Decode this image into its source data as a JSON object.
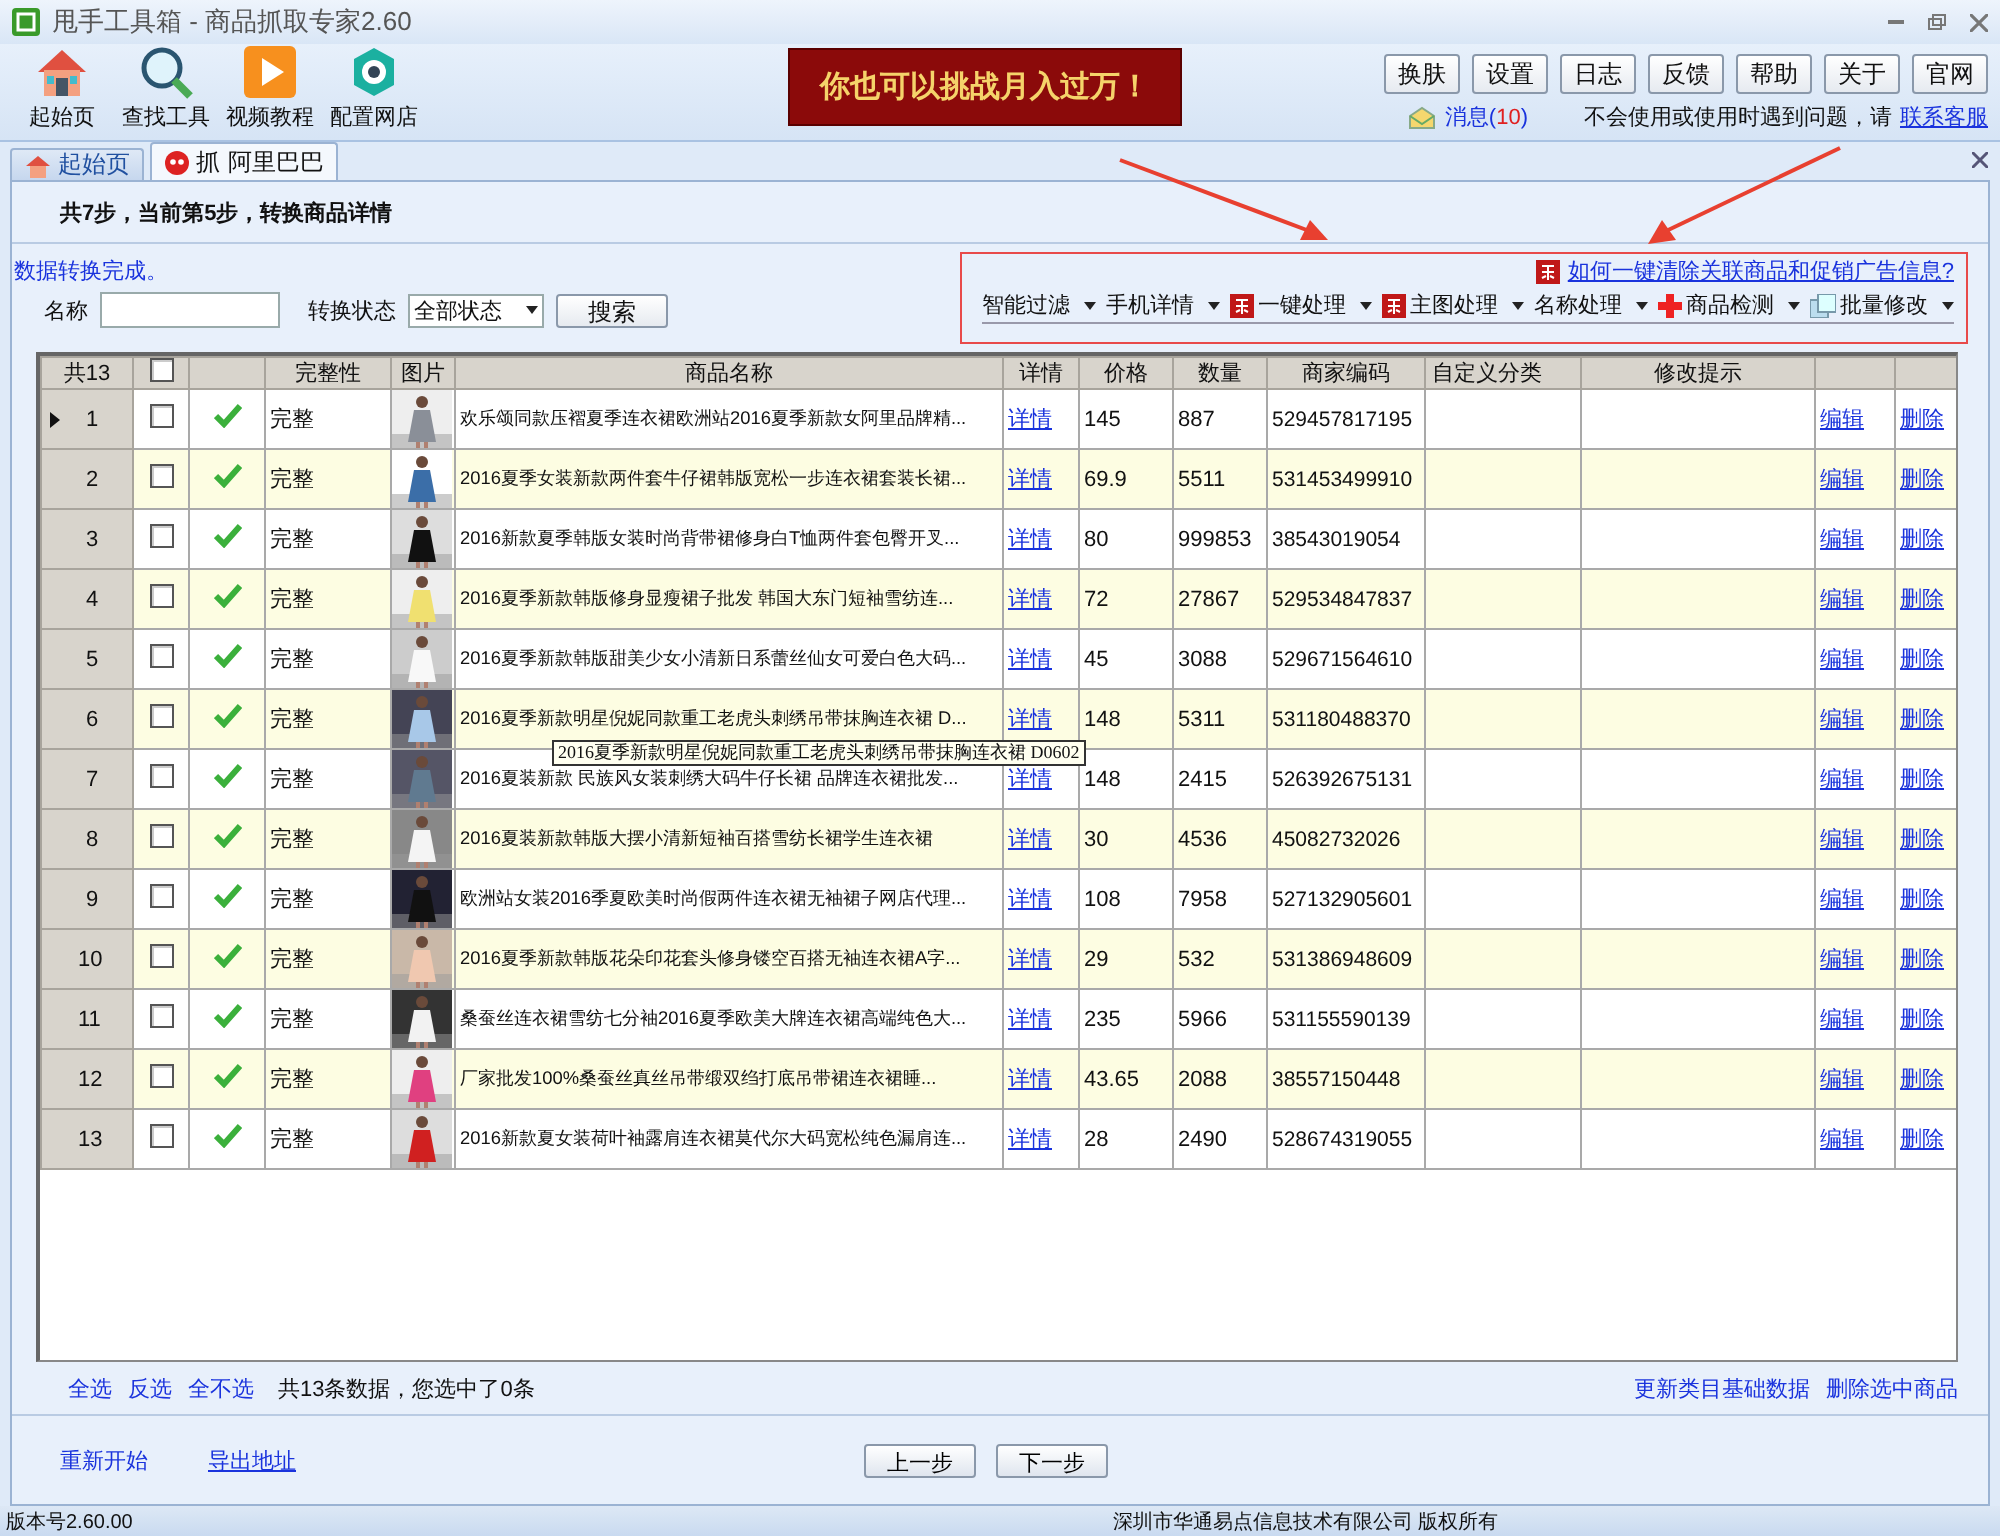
{
  "window": {
    "title": "甩手工具箱 - 商品抓取专家2.60"
  },
  "toolbar": [
    {
      "label": "起始页",
      "kind": "home"
    },
    {
      "label": "查找工具",
      "kind": "search"
    },
    {
      "label": "视频教程",
      "kind": "video"
    },
    {
      "label": "配置网店",
      "kind": "settings"
    }
  ],
  "banner": "你也可以挑战月入过万！",
  "top_buttons": [
    "换肤",
    "设置",
    "日志",
    "反馈",
    "帮助",
    "关于",
    "官网"
  ],
  "messages": {
    "label": "消息(",
    "count": "10",
    "close": ")"
  },
  "help": {
    "text": "不会使用或使用时遇到问题，请",
    "link": "联系客服"
  },
  "tabs": [
    {
      "label": "起始页",
      "selected": false,
      "kind": "home"
    },
    {
      "label": "抓 阿里巴巴",
      "selected": true,
      "kind": "grab"
    }
  ],
  "step": "共7步，当前第5步，转换商品详情",
  "status_message": "数据转换完成。",
  "filter": {
    "name_label": "名称",
    "status_label": "转换状态",
    "status_value": "全部状态",
    "search_button": "搜索"
  },
  "help_link": "如何一键清除关联商品和促销广告信息?",
  "menu": [
    {
      "label": "智能过滤",
      "kind": "plain"
    },
    {
      "label": "手机详情",
      "kind": "plain"
    },
    {
      "label": "一键处理",
      "kind": "new"
    },
    {
      "label": "主图处理",
      "kind": "new"
    },
    {
      "label": "名称处理",
      "kind": "plain"
    },
    {
      "label": "商品检测",
      "kind": "plus"
    },
    {
      "label": "批量修改",
      "kind": "batch"
    }
  ],
  "table": {
    "count_label": "共13",
    "all_checked": false,
    "columns": [
      "完整性",
      "图片",
      "商品名称",
      "详情",
      "价格",
      "数量",
      "商家编码",
      "自定义分类",
      "修改提示"
    ],
    "rows": [
      {
        "index": "1",
        "selected": true,
        "checked": false,
        "complete": true,
        "integrity": "完整",
        "name": "欢乐颂同款压褶夏季连衣裙欧洲站2016夏季新款女阿里品牌精...",
        "detail": "详情",
        "price": "145",
        "qty": "887",
        "code": "529457817195",
        "edit": "编辑",
        "delete": "删除"
      },
      {
        "index": "2",
        "selected": false,
        "checked": false,
        "complete": true,
        "integrity": "完整",
        "name": "2016夏季女装新款两件套牛仔裙韩版宽松一步连衣裙套装长裙...",
        "detail": "详情",
        "price": "69.9",
        "qty": "5511",
        "code": "531453499910",
        "edit": "编辑",
        "delete": "删除"
      },
      {
        "index": "3",
        "selected": false,
        "checked": false,
        "complete": true,
        "integrity": "完整",
        "name": "2016新款夏季韩版女装时尚背带裙修身白T恤两件套包臀开叉...",
        "detail": "详情",
        "price": "80",
        "qty": "999853",
        "code": "38543019054",
        "edit": "编辑",
        "delete": "删除"
      },
      {
        "index": "4",
        "selected": false,
        "checked": false,
        "complete": true,
        "integrity": "完整",
        "name": "2016夏季新款韩版修身显瘦裙子批发 韩国大东门短袖雪纺连...",
        "detail": "详情",
        "price": "72",
        "qty": "27867",
        "code": "529534847837",
        "edit": "编辑",
        "delete": "删除"
      },
      {
        "index": "5",
        "selected": false,
        "checked": false,
        "complete": true,
        "integrity": "完整",
        "name": "2016夏季新款韩版甜美少女小清新日系蕾丝仙女可爱白色大码...",
        "detail": "详情",
        "price": "45",
        "qty": "3088",
        "code": "529671564610",
        "edit": "编辑",
        "delete": "删除"
      },
      {
        "index": "6",
        "selected": false,
        "checked": false,
        "complete": true,
        "integrity": "完整",
        "name": "2016夏季新款明星倪妮同款重工老虎头刺绣吊带抹胸连衣裙 D...",
        "detail": "详情",
        "price": "148",
        "qty": "5311",
        "code": "531180488370",
        "edit": "编辑",
        "delete": "删除"
      },
      {
        "index": "7",
        "selected": false,
        "checked": false,
        "complete": true,
        "integrity": "完整",
        "name": "2016夏装新款 民族风女装刺绣大码牛仔长裙 品牌连衣裙批发...",
        "detail": "详情",
        "price": "148",
        "qty": "2415",
        "code": "526392675131",
        "edit": "编辑",
        "delete": "删除"
      },
      {
        "index": "8",
        "selected": false,
        "checked": false,
        "complete": true,
        "integrity": "完整",
        "name": "2016夏装新款韩版大摆小清新短袖百搭雪纺长裙学生连衣裙",
        "detail": "详情",
        "price": "30",
        "qty": "4536",
        "code": "45082732026",
        "edit": "编辑",
        "delete": "删除"
      },
      {
        "index": "9",
        "selected": false,
        "checked": false,
        "complete": true,
        "integrity": "完整",
        "name": "欧洲站女装2016季夏欧美时尚假两件连衣裙无袖裙子网店代理...",
        "detail": "详情",
        "price": "108",
        "qty": "7958",
        "code": "527132905601",
        "edit": "编辑",
        "delete": "删除"
      },
      {
        "index": "10",
        "selected": false,
        "checked": false,
        "complete": true,
        "integrity": "完整",
        "name": "2016夏季新款韩版花朵印花套头修身镂空百搭无袖连衣裙A字...",
        "detail": "详情",
        "price": "29",
        "qty": "532",
        "code": "531386948609",
        "edit": "编辑",
        "delete": "删除"
      },
      {
        "index": "11",
        "selected": false,
        "checked": false,
        "complete": true,
        "integrity": "完整",
        "name": "桑蚕丝连衣裙雪纺七分袖2016夏季欧美大牌连衣裙高端纯色大...",
        "detail": "详情",
        "price": "235",
        "qty": "5966",
        "code": "531155590139",
        "edit": "编辑",
        "delete": "删除"
      },
      {
        "index": "12",
        "selected": false,
        "checked": false,
        "complete": true,
        "integrity": "完整",
        "name": "厂家批发100%桑蚕丝真丝吊带缎双绉打底吊带裙连衣裙睡...",
        "detail": "详情",
        "price": "43.65",
        "qty": "2088",
        "code": "38557150448",
        "edit": "编辑",
        "delete": "删除"
      },
      {
        "index": "13",
        "selected": false,
        "checked": false,
        "complete": true,
        "integrity": "完整",
        "name": "2016新款夏女装荷叶袖露肩连衣裙莫代尔大码宽松纯色漏肩连...",
        "detail": "详情",
        "price": "28",
        "qty": "2490",
        "code": "528674319055",
        "edit": "编辑",
        "delete": "删除"
      }
    ]
  },
  "tooltip": {
    "text": "2016夏季新款明星倪妮同款重工老虎头刺绣吊带抹胸连衣裙 D0602"
  },
  "selection": {
    "links": [
      "全选",
      "反选",
      "全不选"
    ],
    "summary": "共13条数据，您选中了0条"
  },
  "bulk_links": [
    "更新类目基础数据",
    "删除选中商品"
  ],
  "bottom": {
    "links": [
      "重新开始",
      "导出地址"
    ],
    "buttons": [
      "上一步",
      "下一步"
    ]
  },
  "status_bar": {
    "version": "版本号2.60.00",
    "copyright": "深圳市华通易点信息技术有限公司 版权所有"
  }
}
